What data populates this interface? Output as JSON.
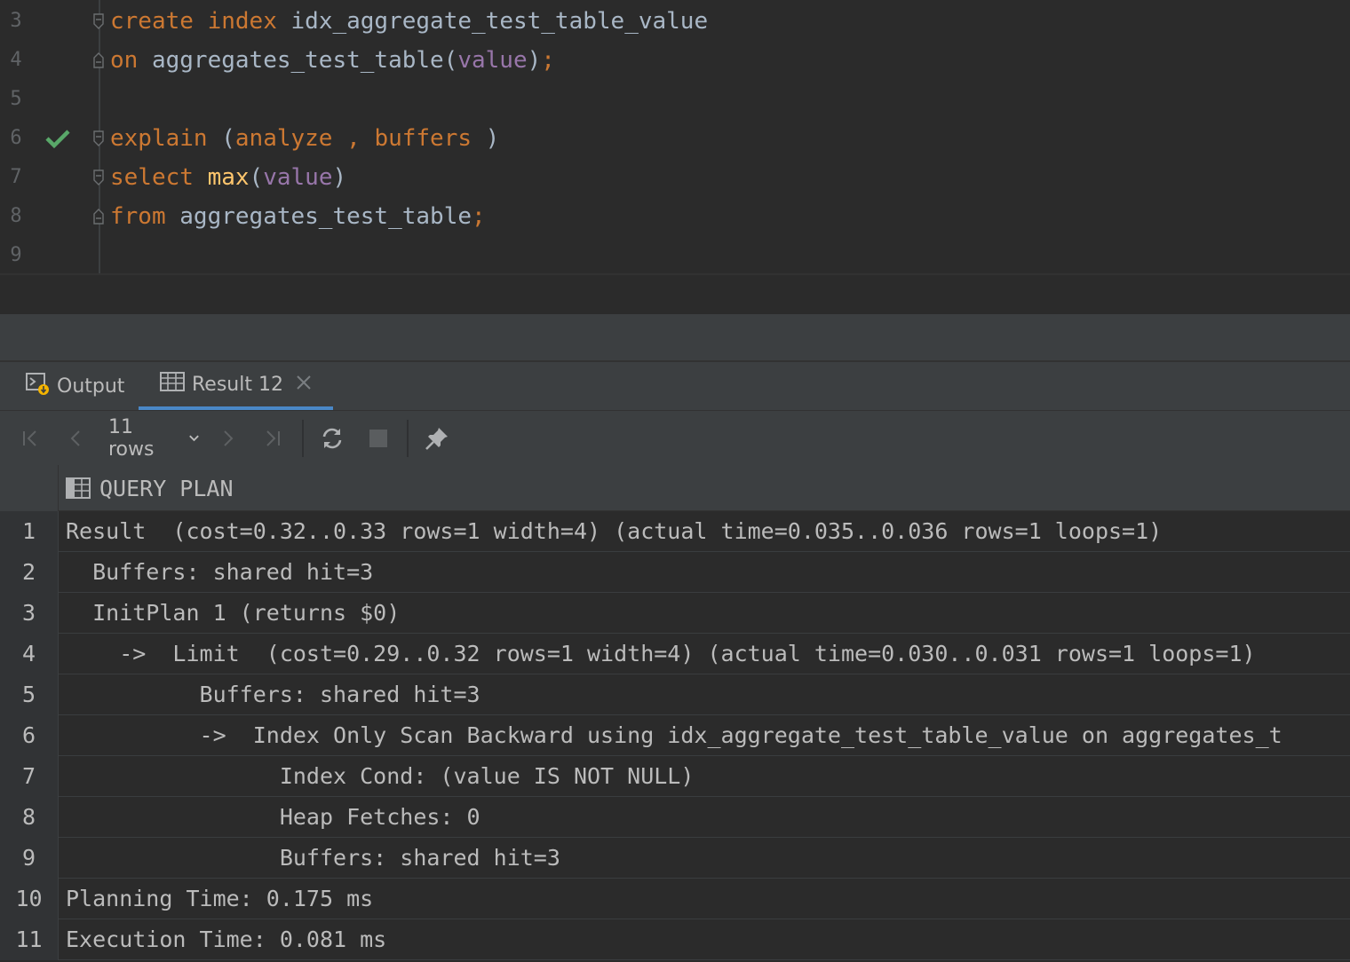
{
  "editor": {
    "lines": [
      {
        "num": "3",
        "tokens": [
          {
            "t": "create",
            "c": "kw"
          },
          {
            "t": " ",
            "c": "pl"
          },
          {
            "t": "index",
            "c": "kw"
          },
          {
            "t": " idx_aggregate_test_table_value",
            "c": "pl"
          }
        ]
      },
      {
        "num": "4",
        "tokens": [
          {
            "t": "on",
            "c": "kw"
          },
          {
            "t": " aggregates_test_table(",
            "c": "pl"
          },
          {
            "t": "value",
            "c": "col"
          },
          {
            "t": ")",
            "c": "pl"
          },
          {
            "t": ";",
            "c": "kw"
          }
        ]
      },
      {
        "num": "5",
        "tokens": []
      },
      {
        "num": "6",
        "tokens": [
          {
            "t": "explain",
            "c": "kw"
          },
          {
            "t": " (",
            "c": "pl"
          },
          {
            "t": "analyze",
            "c": "kw"
          },
          {
            "t": " , ",
            "c": "kw"
          },
          {
            "t": "buffers",
            "c": "kw"
          },
          {
            "t": " )",
            "c": "pl"
          }
        ]
      },
      {
        "num": "7",
        "tokens": [
          {
            "t": "select",
            "c": "kw"
          },
          {
            "t": " ",
            "c": "pl"
          },
          {
            "t": "max",
            "c": "fn"
          },
          {
            "t": "(",
            "c": "pl"
          },
          {
            "t": "value",
            "c": "col"
          },
          {
            "t": ")",
            "c": "pl"
          }
        ]
      },
      {
        "num": "8",
        "tokens": [
          {
            "t": "from",
            "c": "kw"
          },
          {
            "t": " aggregates_test_table",
            "c": "pl"
          },
          {
            "t": ";",
            "c": "kw"
          }
        ]
      },
      {
        "num": "9",
        "tokens": []
      }
    ]
  },
  "colors": {
    "keyword": "#cc7832",
    "function": "#ffc66d",
    "column": "#9876aa",
    "plain": "#a9b7c6",
    "check": "#59a869",
    "accent": "#4a88c7"
  },
  "tabs": [
    {
      "label": "Output",
      "icon": "console-output-icon"
    },
    {
      "label": "Result 12",
      "icon": "table-grid-icon",
      "closable": true
    }
  ],
  "toolbar": {
    "rows_label": "11 rows",
    "icons": [
      "first-page-icon",
      "prev-page-icon",
      "next-page-icon",
      "last-page-icon",
      "refresh-icon",
      "stop-icon",
      "pin-icon"
    ]
  },
  "grid": {
    "column": "QUERY PLAN",
    "rows": [
      {
        "num": "1",
        "text": "Result  (cost=0.32..0.33 rows=1 width=4) (actual time=0.035..0.036 rows=1 loops=1)"
      },
      {
        "num": "2",
        "text": "  Buffers: shared hit=3"
      },
      {
        "num": "3",
        "text": "  InitPlan 1 (returns $0)"
      },
      {
        "num": "4",
        "text": "    ->  Limit  (cost=0.29..0.32 rows=1 width=4) (actual time=0.030..0.031 rows=1 loops=1)"
      },
      {
        "num": "5",
        "text": "          Buffers: shared hit=3"
      },
      {
        "num": "6",
        "text": "          ->  Index Only Scan Backward using idx_aggregate_test_table_value on aggregates_t"
      },
      {
        "num": "7",
        "text": "                Index Cond: (value IS NOT NULL)"
      },
      {
        "num": "8",
        "text": "                Heap Fetches: 0"
      },
      {
        "num": "9",
        "text": "                Buffers: shared hit=3"
      },
      {
        "num": "10",
        "text": "Planning Time: 0.175 ms"
      },
      {
        "num": "11",
        "text": "Execution Time: 0.081 ms"
      }
    ]
  }
}
